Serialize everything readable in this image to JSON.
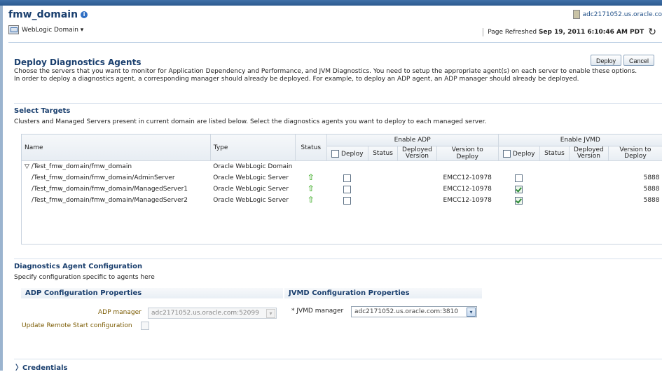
{
  "header": {
    "title": "fmw_domain",
    "domain_menu": "WebLogic Domain ▾",
    "host": "adc2171052.us.oracle.co",
    "refresh_prefix": "Page Refreshed ",
    "refresh_time": "Sep 19, 2011 6:10:46 AM PDT"
  },
  "page": {
    "title": "Deploy Diagnostics Agents",
    "deploy_label": "Deploy",
    "cancel_label": "Cancel",
    "desc1": "Choose the servers that you want to monitor for Application Dependency and Performance, and JVM Diagnostics. You need to setup the appropriate agent(s) on each server to enable these options.",
    "desc2": "In order to deploy a diagnostics agent, a corresponding manager should already be deployed. For example, to deploy an ADP agent, an ADP manager should already be deployed."
  },
  "targets": {
    "title": "Select Targets",
    "desc": "Clusters and Managed Servers present in current domain are listed below. Select the diagnostics agents you want to deploy to each managed server.",
    "group_adp": "Enable ADP",
    "group_jvmd": "Enable JVMD",
    "col_name": "Name",
    "col_type": "Type",
    "col_status": "Status",
    "col_deploy": "Deploy",
    "col_status2": "Status",
    "col_deployed1": "Deployed",
    "col_deployed2": "Version",
    "col_version_to_deploy": "Version to Deploy",
    "col_version_to": "Version to",
    "col_deploy2": "Deploy",
    "rows": [
      {
        "name": "▽ /Test_fmw_domain/fmw_domain",
        "type": "Oracle WebLogic Domain"
      },
      {
        "name": "/Test_fmw_domain/fmw_domain/AdminServer",
        "type": "Oracle WebLogic Server",
        "adp_version": "EMCC12-10978",
        "jvmd_version": "5888"
      },
      {
        "name": "/Test_fmw_domain/fmw_domain/ManagedServer1",
        "type": "Oracle WebLogic Server",
        "adp_version": "EMCC12-10978",
        "jvmd_version": "5888"
      },
      {
        "name": "/Test_fmw_domain/fmw_domain/ManagedServer2",
        "type": "Oracle WebLogic Server",
        "adp_version": "EMCC12-10978",
        "jvmd_version": "5888"
      }
    ],
    "jvmd_checked": [
      false,
      true,
      true
    ]
  },
  "config": {
    "title": "Diagnostics Agent Configuration",
    "desc": "Specify configuration specific to agents here",
    "adp_title": "ADP Configuration Properties",
    "jvmd_title": "JVMD Configuration Properties",
    "adp_manager_label": "ADP manager",
    "adp_manager_value": "adc2171052.us.oracle.com:52099",
    "update_remote_label": "Update Remote Start configuration",
    "jvmd_manager_label": "* JVMD manager",
    "jvmd_manager_value": "adc2171052.us.oracle.com:3810"
  },
  "credentials": {
    "title": "Credentials",
    "toggle": "〉"
  },
  "colors": {
    "accent": "#1a3f6e",
    "topbar": "#2c5a8f",
    "ok": "#4fb339"
  }
}
